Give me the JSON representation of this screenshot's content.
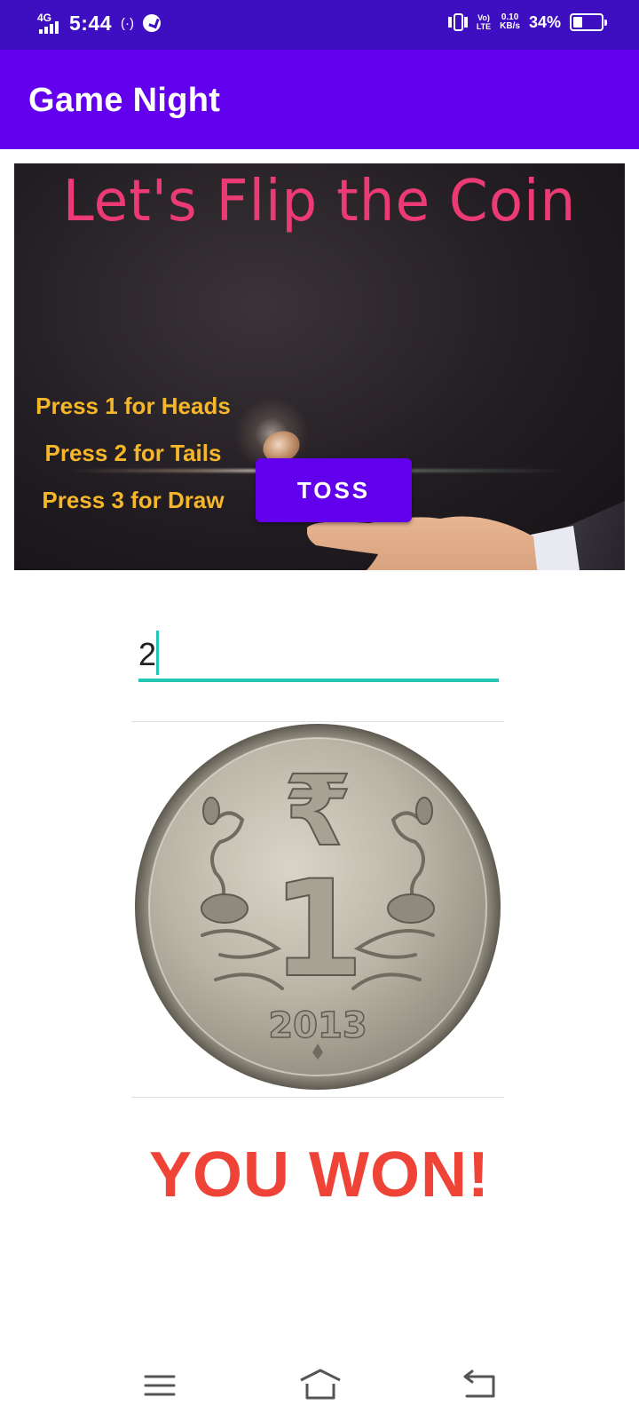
{
  "status_bar": {
    "network_type": "4G",
    "time": "5:44",
    "hotspot": "(·)",
    "volte_line1": "Vo)",
    "volte_line2": "LTE",
    "speed_value": "0.10",
    "speed_unit": "KB/s",
    "battery_percent": "34%",
    "battery_level": 0.34,
    "icons": [
      "signal-icon",
      "hotspot-icon",
      "data-saver-icon",
      "vibrate-icon",
      "battery-icon"
    ]
  },
  "app_bar": {
    "title": "Game Night",
    "color": "#6200ee"
  },
  "banner": {
    "title": "Let's Flip the Coin",
    "toss_button_label": "TOSS",
    "instructions": [
      "Press 1 for Heads",
      "Press 2 for Tails",
      "Press 3 for Draw"
    ]
  },
  "input": {
    "value": "2"
  },
  "coin": {
    "year": "2013",
    "denomination": "1",
    "symbol": "₹"
  },
  "result": {
    "text": "YOU WON!",
    "color": "#f04337"
  },
  "nav_bar": {
    "items": [
      "menu-icon",
      "home-icon",
      "back-icon"
    ]
  }
}
